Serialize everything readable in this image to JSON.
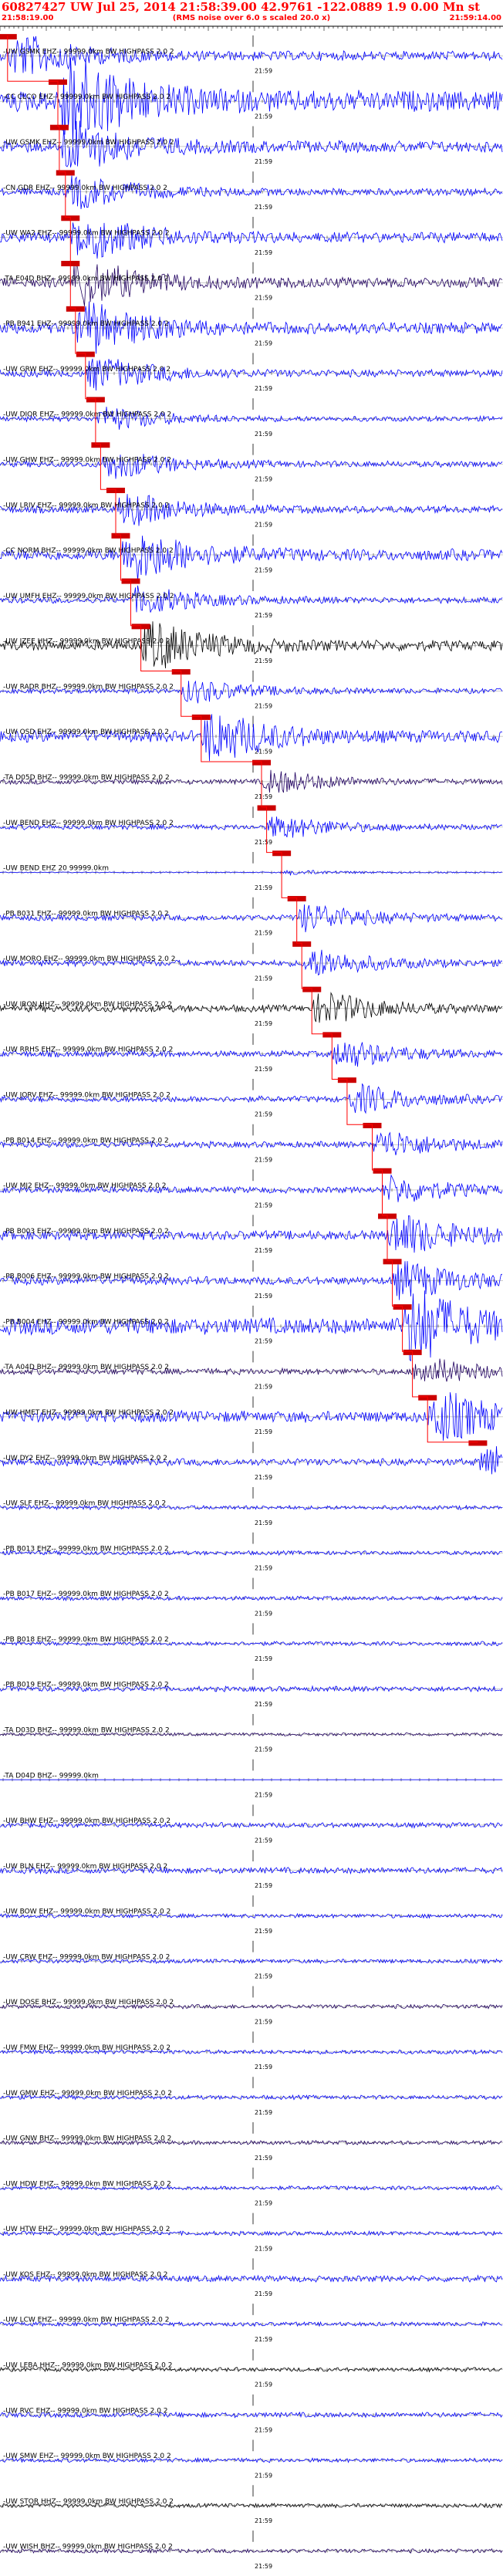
{
  "header": {
    "title": "60827427 UW Jul 25, 2014 21:58:39.00   42.9761 -122.0889  1.9 0.00 Mn st ",
    "subtitle": "(RMS noise over 6.0 s scaled 20.0 x)",
    "start_time": "21:58:19.00",
    "end_time": "21:59:14.00"
  },
  "chart_data": {
    "type": "seismogram",
    "tick_label": "21:59",
    "traces": [
      {
        "label": "-UW GSMK EHZ-- 99999.0km BW  HIGHPASS  2.0  2",
        "color": "#0000ff",
        "amplitude": 0.45,
        "pick": 0.015
      },
      {
        "label": "-CC CLCO EHZ-- 99999.0km BW  HIGHPASS  2.0  2",
        "color": "#0000ff",
        "amplitude": 1.0,
        "pick": 0.115
      },
      {
        "label": "-UW GSMK EHZ-- 99999.0km BW  HIGHPASS  2.0  2",
        "color": "#0000ff",
        "amplitude": 0.55,
        "pick": 0.118
      },
      {
        "label": "-CN GDR EHZ-- 99999.0km BW  HIGHPASS  2.0  2",
        "color": "#0000ff",
        "amplitude": 0.35,
        "pick": 0.13
      },
      {
        "label": "-UW WA2 EHZ-- 99999.0km BW  HIGHPASS  2.0  2",
        "color": "#0000ff",
        "amplitude": 0.5,
        "pick": 0.14
      },
      {
        "label": "-TA E04D BHZ-- 99999.0km BW  HIGHPASS  2.0  2",
        "color": "#200060",
        "amplitude": 0.5,
        "pick": 0.14
      },
      {
        "label": "-PB B941 EHZ-- 99999.0km BW  HIGHPASS  2.0  2",
        "color": "#0000ff",
        "amplitude": 0.55,
        "pick": 0.15
      },
      {
        "label": "-UW GRW EHZ-- 99999.0km BW  HIGHPASS  2.0  2",
        "color": "#0000ff",
        "amplitude": 0.35,
        "pick": 0.17
      },
      {
        "label": "-UW DIOR EHZ-- 99999.0km BW  HIGHPASS  2.0  2",
        "color": "#0000ff",
        "amplitude": 0.25,
        "pick": 0.19
      },
      {
        "label": "-UW GHW EHZ-- 99999.0km BW  HIGHPASS  2.0  2",
        "color": "#0000ff",
        "amplitude": 0.3,
        "pick": 0.2
      },
      {
        "label": "-UW LRIV EHZ-- 99999.0km BW  HIGHPASS  2.0  2",
        "color": "#0000ff",
        "amplitude": 0.35,
        "pick": 0.23
      },
      {
        "label": "-CC NORM BHZ-- 99999.0km BW  HIGHPASS  2.0  2",
        "color": "#0000ff",
        "amplitude": 0.55,
        "pick": 0.24
      },
      {
        "label": "-UW UMFH EHZ-- 99999.0km BW  HIGHPASS  2.0  2",
        "color": "#0000ff",
        "amplitude": 0.3,
        "pick": 0.26
      },
      {
        "label": "-UW IZEE HHZ-- 99999.0km BW  HIGHPASS  2.0  2",
        "color": "#000000",
        "amplitude": 0.5,
        "pick": 0.28
      },
      {
        "label": "-UW RADR BHZ-- 99999.0km BW  HIGHPASS  2.0  2",
        "color": "#0000ff",
        "amplitude": 0.25,
        "pick": 0.36
      },
      {
        "label": "-UW OSD EHZ-- 99999.0km BW  HIGHPASS  2.0  2",
        "color": "#0000ff",
        "amplitude": 0.55,
        "pick": 0.4
      },
      {
        "label": "-TA D05D BHZ-- 99999.0km BW  HIGHPASS  2.0  2",
        "color": "#200060",
        "amplitude": 0.25,
        "pick": 0.52
      },
      {
        "label": "-UW BEND EHZ-- 99999.0km BW  HIGHPASS  2.0  2",
        "color": "#0000ff",
        "amplitude": 0.25,
        "pick": 0.53
      },
      {
        "label": "-UW BEND EHZ 20 99999.0km",
        "color": "#0000ff",
        "amplitude": 0.05,
        "pick": 0.56
      },
      {
        "label": "-PB B031 EHZ-- 99999.0km BW  HIGHPASS  2.0  2",
        "color": "#0000ff",
        "amplitude": 0.3,
        "pick": 0.59
      },
      {
        "label": "-UW MORO EHZ-- 99999.0km BW  HIGHPASS  2.0  2",
        "color": "#0000ff",
        "amplitude": 0.3,
        "pick": 0.6
      },
      {
        "label": "-UW IRON HHZ-- 99999.0km BW  HIGHPASS  2.0  2",
        "color": "#000000",
        "amplitude": 0.35,
        "pick": 0.62
      },
      {
        "label": "-UW RRHS EHZ-- 99999.0km BW  HIGHPASS  2.0  2",
        "color": "#0000ff",
        "amplitude": 0.3,
        "pick": 0.66
      },
      {
        "label": "-UW JORV EHZ-- 99999.0km BW  HIGHPASS  2.0  2",
        "color": "#0000ff",
        "amplitude": 0.3,
        "pick": 0.69
      },
      {
        "label": "-PB B014 EHZ-- 99999.0km BW  HIGHPASS  2.0  2",
        "color": "#0000ff",
        "amplitude": 0.3,
        "pick": 0.74
      },
      {
        "label": "-UW MJ2 EHZ-- 99999.0km BW  HIGHPASS  2.0  2",
        "color": "#0000ff",
        "amplitude": 0.3,
        "pick": 0.76
      },
      {
        "label": "-PB B003 EHZ-- 99999.0km BW  HIGHPASS  2.0  2",
        "color": "#0000ff",
        "amplitude": 0.45,
        "pick": 0.77
      },
      {
        "label": "-PB B006 EHZ-- 99999.0km BW  HIGHPASS  2.0  2",
        "color": "#0000ff",
        "amplitude": 0.4,
        "pick": 0.78
      },
      {
        "label": "-PB B004 EHZ-- 99999.0km BW  HIGHPASS  2.0  2",
        "color": "#0000ff",
        "amplitude": 0.8,
        "pick": 0.8
      },
      {
        "label": "-TA A04D BHZ-- 99999.0km BW  HIGHPASS  2.0  2",
        "color": "#200060",
        "amplitude": 0.3,
        "pick": 0.82
      },
      {
        "label": "-UW HMET EHZ-- 99999.0km BW  HIGHPASS  2.0  2",
        "color": "#0000ff",
        "amplitude": 0.55,
        "pick": 0.85
      },
      {
        "label": "-UW DY2 EHZ-- 99999.0km BW  HIGHPASS  2.0  2",
        "color": "#0000ff",
        "amplitude": 0.35,
        "pick": 0.95
      },
      {
        "label": "-UW SLF EHZ-- 99999.0km BW  HIGHPASS  2.0  2",
        "color": "#0000ff",
        "amplitude": 0.2,
        "pick": null
      },
      {
        "label": "-PB B013 EHZ-- 99999.0km BW  HIGHPASS  2.0  2",
        "color": "#0000ff",
        "amplitude": 0.2,
        "pick": null
      },
      {
        "label": "-PB B017 EHZ-- 99999.0km BW  HIGHPASS  2.0  2",
        "color": "#0000ff",
        "amplitude": 0.2,
        "pick": null
      },
      {
        "label": "-PB B018 EHZ-- 99999.0km BW  HIGHPASS  2.0  2",
        "color": "#0000ff",
        "amplitude": 0.2,
        "pick": null
      },
      {
        "label": "-PB B019 EHZ-- 99999.0km BW  HIGHPASS  2.0  2",
        "color": "#0000ff",
        "amplitude": 0.25,
        "pick": null
      },
      {
        "label": "-TA D03D BHZ-- 99999.0km BW  HIGHPASS  2.0  2",
        "color": "#200060",
        "amplitude": 0.15,
        "pick": null
      },
      {
        "label": "-TA D04D BHZ-- 99999.0km",
        "color": "#0000ff",
        "amplitude": 0.0,
        "pick": null
      },
      {
        "label": "-UW BHW EHZ-- 99999.0km BW  HIGHPASS  2.0  2",
        "color": "#0000ff",
        "amplitude": 0.25,
        "pick": null
      },
      {
        "label": "-UW BLN EHZ-- 99999.0km BW  HIGHPASS  2.0  2",
        "color": "#0000ff",
        "amplitude": 0.3,
        "pick": null
      },
      {
        "label": "-UW BOW EHZ-- 99999.0km BW  HIGHPASS  2.0  2",
        "color": "#0000ff",
        "amplitude": 0.2,
        "pick": null
      },
      {
        "label": "-UW CRW EHZ-- 99999.0km BW  HIGHPASS  2.0  2",
        "color": "#0000ff",
        "amplitude": 0.2,
        "pick": null
      },
      {
        "label": "-UW DOSE BHZ-- 99999.0km BW  HIGHPASS  2.0  2",
        "color": "#200060",
        "amplitude": 0.2,
        "pick": null
      },
      {
        "label": "-UW FMW EHZ-- 99999.0km BW  HIGHPASS  2.0  2",
        "color": "#0000ff",
        "amplitude": 0.2,
        "pick": null
      },
      {
        "label": "-UW GMW EHZ-- 99999.0km BW  HIGHPASS  2.0  2",
        "color": "#0000ff",
        "amplitude": 0.2,
        "pick": null
      },
      {
        "label": "-UW GNW BHZ-- 99999.0km BW  HIGHPASS  2.0  2",
        "color": "#200060",
        "amplitude": 0.2,
        "pick": null
      },
      {
        "label": "-UW HDW EHZ-- 99999.0km BW  HIGHPASS  2.0  2",
        "color": "#0000ff",
        "amplitude": 0.2,
        "pick": null
      },
      {
        "label": "-UW HTW EHZ-- 99999.0km BW  HIGHPASS  2.0  2",
        "color": "#0000ff",
        "amplitude": 0.2,
        "pick": null
      },
      {
        "label": "-UW KOS EHZ-- 99999.0km BW  HIGHPASS  2.0  2",
        "color": "#0000ff",
        "amplitude": 0.3,
        "pick": null
      },
      {
        "label": "-UW LCW EHZ-- 99999.0km BW  HIGHPASS  2.0  2",
        "color": "#0000ff",
        "amplitude": 0.2,
        "pick": null
      },
      {
        "label": "-UW LEBA HHZ-- 99999.0km BW  HIGHPASS  2.0  2",
        "color": "#000000",
        "amplitude": 0.2,
        "pick": null
      },
      {
        "label": "-UW RVC EHZ-- 99999.0km BW  HIGHPASS  2.0  2",
        "color": "#0000ff",
        "amplitude": 0.25,
        "pick": null
      },
      {
        "label": "-UW SMW EHZ-- 99999.0km BW  HIGHPASS  2.0  2",
        "color": "#0000ff",
        "amplitude": 0.2,
        "pick": null
      },
      {
        "label": "-UW STOR HHZ-- 99999.0km BW  HIGHPASS  2.0  2",
        "color": "#000000",
        "amplitude": 0.2,
        "pick": null
      },
      {
        "label": "-UW WISH BHZ-- 99999.0km BW  HIGHPASS  2.0  2",
        "color": "#200060",
        "amplitude": 0.2,
        "pick": null
      }
    ]
  }
}
